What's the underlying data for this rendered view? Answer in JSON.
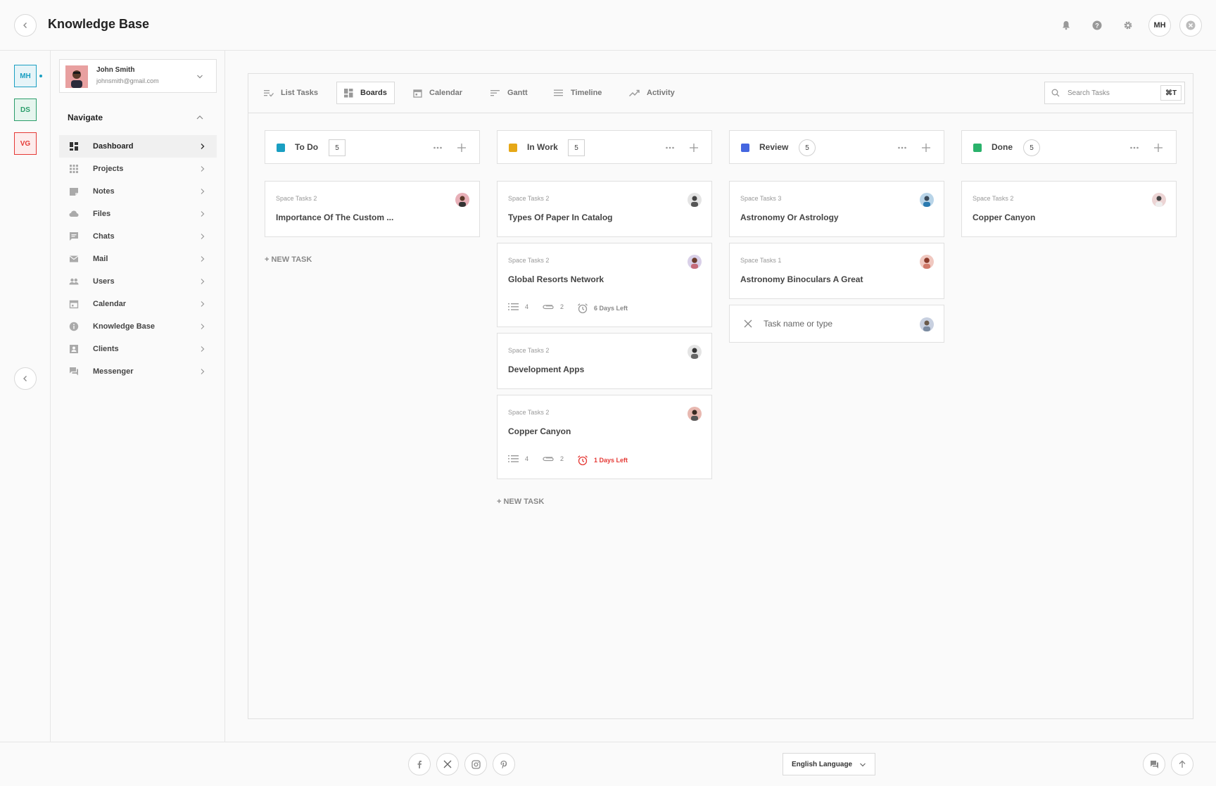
{
  "header": {
    "title": "Knowledge Base",
    "user_initials": "MH",
    "icons": [
      "back-icon",
      "bell-icon",
      "help-icon",
      "gear-icon",
      "close-icon"
    ]
  },
  "workspaces": [
    {
      "label": "MH",
      "color": "#1a9fc2",
      "bg": "#e6f4f8"
    },
    {
      "label": "DS",
      "color": "#2a9d6a",
      "bg": "#e6f5ee"
    },
    {
      "label": "VG",
      "color": "#e53935",
      "bg": "#fdecec"
    }
  ],
  "user": {
    "name": "John Smith",
    "email": "johnsmith@gmail.com"
  },
  "sidebar": {
    "title": "Navigate",
    "items": [
      {
        "label": "Dashboard",
        "icon": "dashboard-icon"
      },
      {
        "label": "Projects",
        "icon": "grid-icon"
      },
      {
        "label": "Notes",
        "icon": "notes-icon"
      },
      {
        "label": "Files",
        "icon": "cloud-icon"
      },
      {
        "label": "Chats",
        "icon": "chat-icon"
      },
      {
        "label": "Mail",
        "icon": "mail-icon"
      },
      {
        "label": "Users",
        "icon": "users-icon"
      },
      {
        "label": "Calendar",
        "icon": "calendar-icon"
      },
      {
        "label": "Knowledge Base",
        "icon": "info-icon"
      },
      {
        "label": "Clients",
        "icon": "contact-icon"
      },
      {
        "label": "Messenger",
        "icon": "messenger-icon"
      }
    ]
  },
  "tabs": [
    {
      "label": "List Tasks",
      "icon": "list-check-icon"
    },
    {
      "label": "Boards",
      "icon": "boards-icon",
      "active": true
    },
    {
      "label": "Calendar",
      "icon": "calendar-icon"
    },
    {
      "label": "Gantt",
      "icon": "gantt-icon"
    },
    {
      "label": "Timeline",
      "icon": "timeline-icon"
    },
    {
      "label": "Activity",
      "icon": "trend-icon"
    }
  ],
  "search": {
    "placeholder": "Search Tasks",
    "shortcut": "⌘T"
  },
  "columns": [
    {
      "title": "To Do",
      "count": "5",
      "color": "#1a9fc2",
      "cards": [
        {
          "sub": "Space Tasks 2",
          "title": "Importance Of The Custom ..."
        }
      ],
      "new_task": "+ NEW TASK"
    },
    {
      "title": "In Work",
      "count": "5",
      "color": "#e6a817",
      "cards": [
        {
          "sub": "Space Tasks 2",
          "title": "Types Of Paper In Catalog"
        },
        {
          "sub": "Space Tasks 2",
          "title": "Global Resorts Network",
          "checklist": "4",
          "attachments": "2",
          "due": "6 Days Left"
        },
        {
          "sub": "Space Tasks 2",
          "title": "Development Apps"
        },
        {
          "sub": "Space Tasks 2",
          "title": "Copper Canyon",
          "checklist": "4",
          "attachments": "2",
          "due": "1 Days Left"
        }
      ],
      "new_task": "+ NEW TASK"
    },
    {
      "title": "Review",
      "count": "5",
      "color": "#4466e0",
      "cards": [
        {
          "sub": "Space Tasks 3",
          "title": "Astronomy Or Astrology"
        },
        {
          "sub": "Space Tasks 1",
          "title": "Astronomy Binoculars A Great"
        }
      ],
      "task_input_placeholder": "Task name or type"
    },
    {
      "title": "Done",
      "count": "5",
      "color": "#2ab26b",
      "cards": [
        {
          "sub": "Space Tasks 2",
          "title": "Copper Canyon"
        }
      ]
    }
  ],
  "footer": {
    "social": [
      "facebook-icon",
      "x-icon",
      "instagram-icon",
      "pinterest-icon"
    ],
    "language": "English Language"
  }
}
